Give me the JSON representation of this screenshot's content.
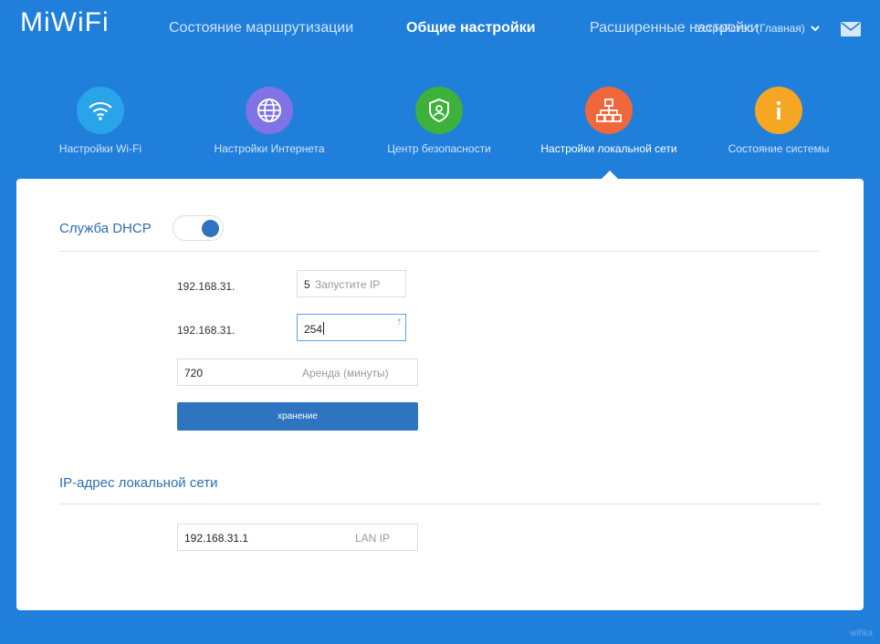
{
  "header": {
    "logo": "MiWiFi",
    "nav": [
      {
        "label": "Состояние маршрутизации"
      },
      {
        "label": "Общие настройки"
      },
      {
        "label": "Расширенные настройки"
      }
    ],
    "device": "Устройство (Главная)"
  },
  "tiles": [
    {
      "label": "Настройки Wi-Fi",
      "color": "#29a4e8",
      "icon": "wifi-icon"
    },
    {
      "label": "Настройки Интернета",
      "color": "#7f73e6",
      "icon": "globe-icon"
    },
    {
      "label": "Центр безопасности",
      "color": "#3db13c",
      "icon": "shield-user-icon"
    },
    {
      "label": "Настройки локальной сети",
      "color": "#f0673b",
      "icon": "network-icon"
    },
    {
      "label": "Состояние системы",
      "color": "#f5a623",
      "icon": "info-icon"
    }
  ],
  "dhcp": {
    "title": "Служба DHCP",
    "enabled": true,
    "start": {
      "prefix": "192.168.31.",
      "value": "5",
      "placeholder": "Запустите IP"
    },
    "end": {
      "prefix": "192.168.31.",
      "value": "254"
    },
    "lease": {
      "value": "720",
      "placeholder": "Аренда (минуты)"
    },
    "save_label": "хранение"
  },
  "lan": {
    "title": "IP-адрес локальной сети",
    "value": "192.168.31.1",
    "placeholder": "LAN IP"
  },
  "watermark": "wifika"
}
